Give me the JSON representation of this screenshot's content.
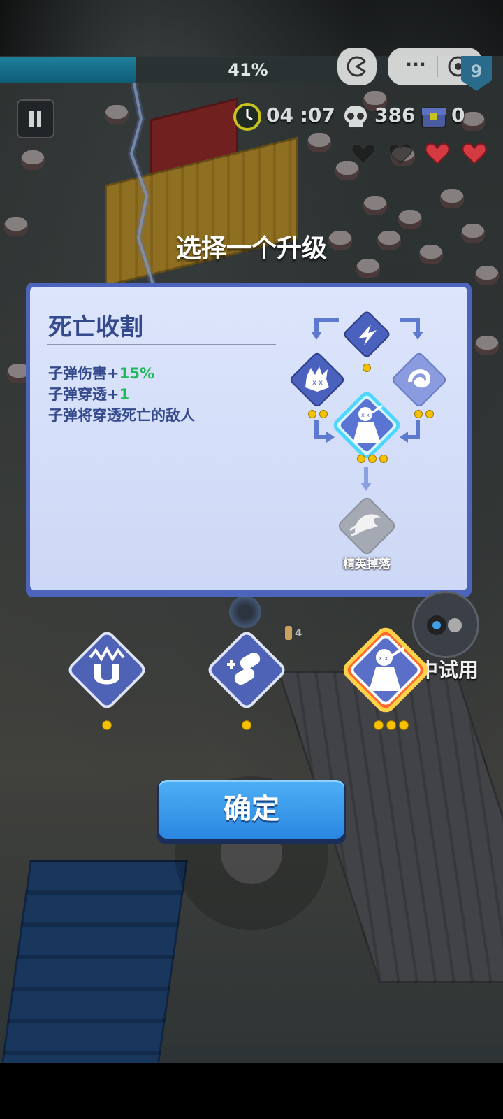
{
  "hud": {
    "progress_percent": 41,
    "progress_label": "41%",
    "timer": "04 :07",
    "kills": "386",
    "chests": "0",
    "level_badge": "9",
    "menu_dots": "···",
    "hearts_full": 2,
    "hearts_empty": 2
  },
  "title": "选择一个升级",
  "panel": {
    "skill_name": "死亡收割",
    "stats": [
      {
        "prefix": "子弹伤害+",
        "value": "15%"
      },
      {
        "prefix": "子弹穿透+",
        "value": "1"
      },
      {
        "prefix": "子弹将穿透死亡的敌人",
        "value": ""
      }
    ],
    "elite_drop_label": "精英掉落"
  },
  "trial_label": "中试用",
  "ammo_count": "4",
  "confirm_label": "确定",
  "colors": {
    "panel_border": "#4d64bd",
    "panel_bg": "#dce5fb",
    "text_blue": "#344a8c",
    "stat_green": "#20b85a",
    "confirm_blue": "#3a9ced",
    "dot_yellow": "#f6c200",
    "progress_teal": "#1e7f9a",
    "heart_red": "#d33a42"
  }
}
